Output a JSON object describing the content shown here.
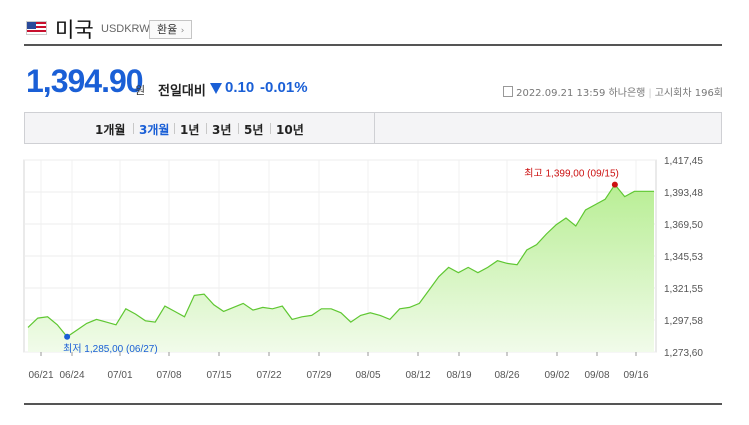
{
  "header": {
    "country": "미국",
    "code": "USDKRW",
    "fx_button": "환율",
    "flag_icon": "us-flag-icon"
  },
  "quote": {
    "price": "1,394.90",
    "unit": "원",
    "compare_label": "전일대비",
    "direction_icon": "down-triangle-icon",
    "change": "0.10",
    "change_pct": "-0.01%"
  },
  "meta": {
    "timestamp": "2022.09.21 13:59",
    "bank": "하나은행",
    "notice": "고시회차 196회"
  },
  "tabs": [
    {
      "label": "1개월",
      "active": false
    },
    {
      "label": "3개월",
      "active": true
    },
    {
      "label": "1년",
      "active": false
    },
    {
      "label": "3년",
      "active": false
    },
    {
      "label": "5년",
      "active": false
    },
    {
      "label": "10년",
      "active": false
    }
  ],
  "colors": {
    "accent": "#1a5fd6",
    "line": "#5fc732",
    "area_top": "#b8ee94",
    "area_bottom": "#f1fbea",
    "high": "#cc1111",
    "low": "#1a5fd6"
  },
  "chart_data": {
    "type": "area",
    "x_ticks": [
      "06/21",
      "06/24",
      "07/01",
      "07/08",
      "07/15",
      "07/22",
      "07/29",
      "08/05",
      "08/12",
      "08/19",
      "08/26",
      "09/02",
      "09/08",
      "09/16"
    ],
    "y_ticks": [
      "1,417,45",
      "1,393,48",
      "1,369,50",
      "1,345,53",
      "1,321,55",
      "1,297,58",
      "1,273,60"
    ],
    "ylim": [
      1273.6,
      1417.45
    ],
    "grid": true,
    "high_label": "최고 1,399,00 (09/15)",
    "low_label": "최저 1,285,00 (06/27)",
    "high": {
      "date": "09/15",
      "value": 1399.0
    },
    "low": {
      "date": "06/27",
      "value": 1285.0
    },
    "series": [
      {
        "values": [
          1292,
          1299,
          1300,
          1294,
          1285,
          1290,
          1295,
          1298,
          1296,
          1294,
          1306,
          1302,
          1297,
          1296,
          1308,
          1304,
          1300,
          1316,
          1317,
          1309,
          1304,
          1307,
          1310,
          1305,
          1307,
          1306,
          1308,
          1298,
          1300,
          1301,
          1306,
          1306,
          1303,
          1296,
          1301,
          1303,
          1301,
          1298,
          1306,
          1307,
          1310,
          1320,
          1330,
          1337,
          1333,
          1337,
          1333,
          1337,
          1342,
          1340,
          1339,
          1350,
          1354,
          1362,
          1369,
          1374,
          1368,
          1380,
          1384,
          1388,
          1399,
          1390,
          1394,
          1394,
          1394
        ]
      }
    ]
  }
}
